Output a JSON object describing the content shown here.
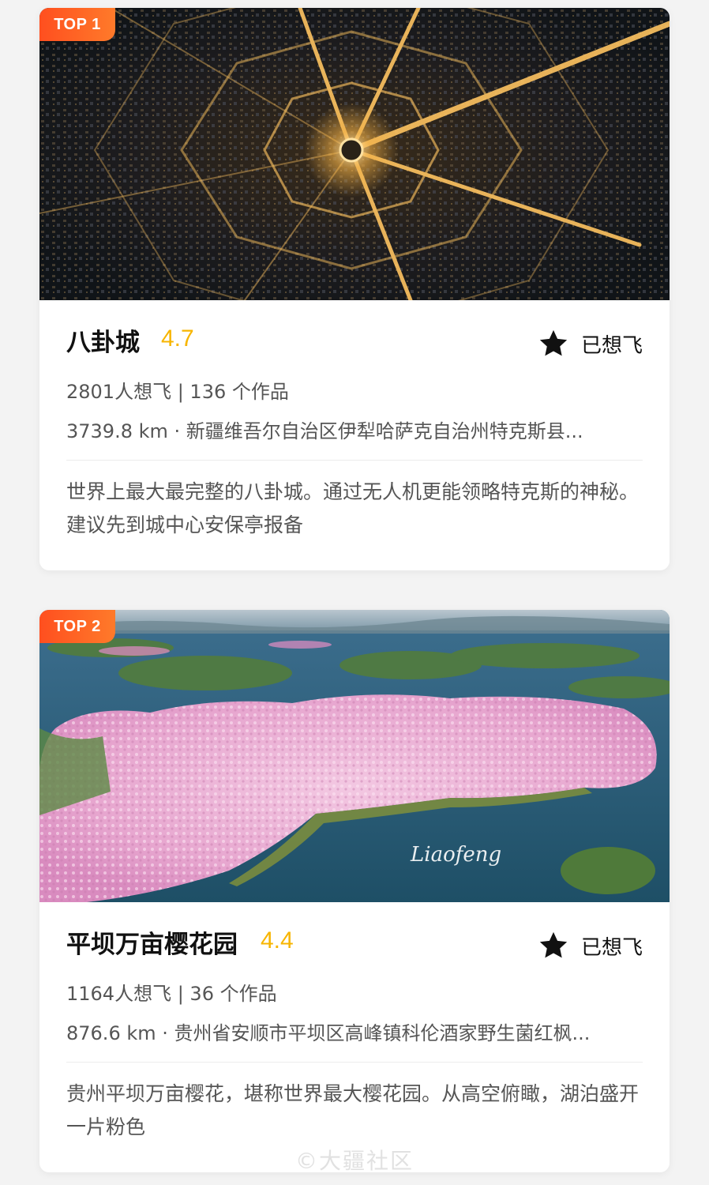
{
  "cards": [
    {
      "badge": "TOP 1",
      "title": "八卦城",
      "rating": "4.7",
      "flag_label": "已想飞",
      "stats": "2801人想飞 | 136 个作品",
      "location": "3739.8 km · 新疆维吾尔自治区伊犁哈萨克自治州特克斯县...",
      "description": "世界上最大最完整的八卦城。通过无人机更能领略特克斯的神秘。建议先到城中心安保亭报备",
      "image": "aerial-night-octagonal-city"
    },
    {
      "badge": "TOP 2",
      "title": "平坝万亩樱花园",
      "rating": "4.4",
      "flag_label": "已想飞",
      "stats": "1164人想飞 | 36 个作品",
      "location": "876.6 km · 贵州省安顺市平坝区高峰镇科伦酒家野生菌红枫...",
      "description": "贵州平坝万亩樱花，堪称世界最大樱花园。从高空俯瞰，湖泊盛开一片粉色",
      "image": "aerial-cherry-blossom-lake",
      "photo_signature": "Liaofeng"
    }
  ],
  "watermark": "©大疆社区",
  "icons": {
    "flag": "star-icon"
  },
  "colors": {
    "badge": "#ff5a22",
    "rating": "#f7b500",
    "title": "#111111",
    "secondary_text": "#555555"
  }
}
